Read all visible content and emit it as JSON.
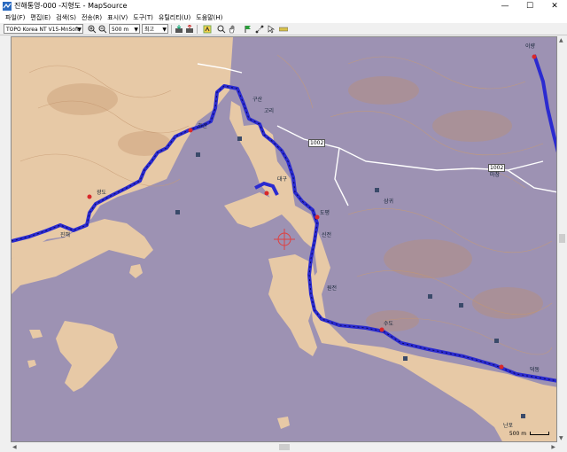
{
  "window": {
    "title": "진해통영-000 -지형도 - MapSource",
    "minimize": "—",
    "maximize": "☐",
    "close": "✕"
  },
  "menu": [
    "파일(F)",
    "편집(E)",
    "검색(S)",
    "전송(R)",
    "표시(V)",
    "도구(T)",
    "유틸리티(U)",
    "도움말(H)"
  ],
  "toolbar": {
    "map_product": "TOPO Korea NT V15-MnSoft",
    "zoom_value": "500 m",
    "detail_value": "최고"
  },
  "map": {
    "colors": {
      "water": "#9d92b3",
      "land": "#e7c9a6",
      "route": "#2b2bd0",
      "road": "#ffffff"
    },
    "road_labels": [
      "1002",
      "1002"
    ],
    "places": [
      "진해",
      "광도",
      "호산",
      "구산",
      "고리",
      "대구",
      "도평",
      "신전",
      "원전",
      "수도",
      "이량",
      "덕동",
      "난포",
      "마창",
      "삼귀"
    ],
    "scale_label": "500 m"
  }
}
